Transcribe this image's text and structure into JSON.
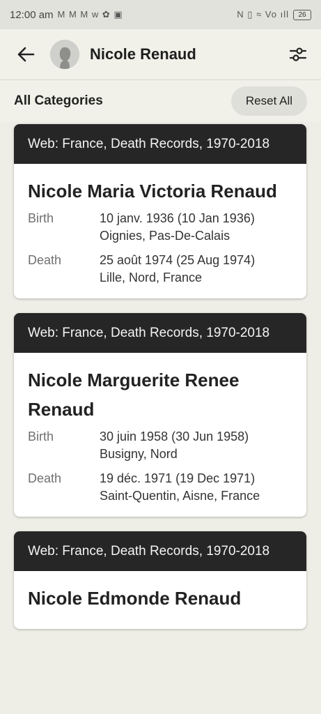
{
  "status_bar": {
    "time": "12:00 am",
    "left_icons": "M M M w ✿ ▣",
    "right_icons": "N ▯ ≈ Vo ıll",
    "battery": "26"
  },
  "header": {
    "title": "Nicole Renaud"
  },
  "category_bar": {
    "label": "All Categories",
    "reset_label": "Reset All"
  },
  "records": [
    {
      "source": "Web: France, Death Records, 1970-2018",
      "name": "Nicole Maria Victoria Renaud",
      "events": [
        {
          "label": "Birth",
          "date": "10 janv. 1936 (10 Jan 1936)",
          "place": "Oignies, Pas-De-Calais"
        },
        {
          "label": "Death",
          "date": "25 août 1974 (25 Aug 1974)",
          "place": "Lille, Nord, France"
        }
      ]
    },
    {
      "source": "Web: France, Death Records, 1970-2018",
      "name": "Nicole Marguerite Renee Renaud",
      "events": [
        {
          "label": "Birth",
          "date": "30 juin 1958 (30 Jun 1958)",
          "place": "Busigny, Nord"
        },
        {
          "label": "Death",
          "date": "19 déc. 1971 (19 Dec 1971)",
          "place": "Saint-Quentin, Aisne, France"
        }
      ]
    },
    {
      "source": "Web: France, Death Records, 1970-2018",
      "name": "Nicole Edmonde Renaud",
      "events": []
    }
  ]
}
